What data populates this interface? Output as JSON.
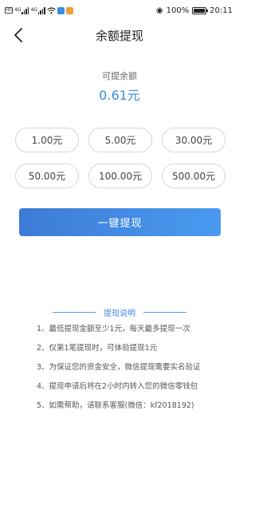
{
  "status_bar": {
    "carrier_badge": "HD",
    "signal_labels": [
      "4G",
      "4G"
    ],
    "battery_percent_text": "100%",
    "battery_level": 1.0,
    "time": "20:11",
    "app_icon_colors": [
      "#3b8be0",
      "#e8a33a"
    ]
  },
  "nav": {
    "title": "余额提现",
    "back_icon": "chevron-left-icon"
  },
  "balance": {
    "label": "可提余额",
    "value": "0.61元",
    "accent_color": "#3b8be0"
  },
  "amount_options": [
    {
      "label": "1.00元"
    },
    {
      "label": "5.00元"
    },
    {
      "label": "30.00元"
    },
    {
      "label": "50.00元"
    },
    {
      "label": "100.00元"
    },
    {
      "label": "500.00元"
    }
  ],
  "withdraw_button": {
    "label": "一键提现",
    "color_start": "#3d7bd6",
    "color_end": "#4a9af0"
  },
  "notes": {
    "title": "提现说明",
    "items": [
      "1、最低提现金额至少1元，每天最多提现一次",
      "2、仅第1笔提现时，可体验提现1元",
      "3、为保证您的资金安全，微信提现需要实名验证",
      "4、提现申请后将在2小时内转入您的微信零钱包",
      "5、如需帮助，请联系客服(微信：kf2018192)"
    ]
  }
}
